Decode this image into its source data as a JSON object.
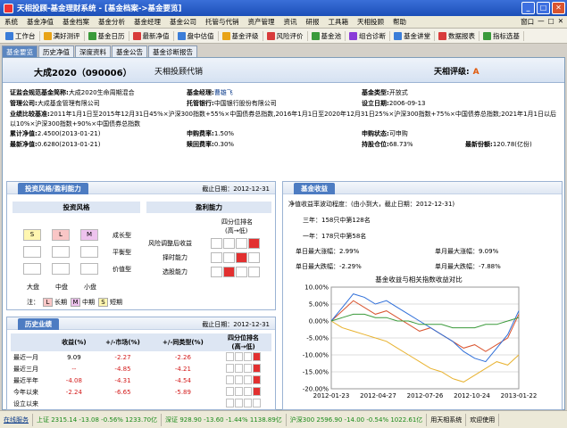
{
  "window": {
    "title": "天相投顾-基金理财系统 - [基金档案->基金要览]"
  },
  "menu": [
    "系统",
    "基金净值",
    "基金档案",
    "基金分析",
    "基金经理",
    "基金公司",
    "托管与代销",
    "资产管理",
    "资讯",
    "研报",
    "工具箱",
    "天相投顾",
    "帮助"
  ],
  "menu_right": [
    "窗口",
    "—",
    "□",
    "✕"
  ],
  "toolbar": [
    {
      "label": "工作台",
      "icon": "home-icon",
      "color": "#3b7dd8"
    },
    {
      "label": "满好测评",
      "icon": "star-icon",
      "color": "#e8a317"
    },
    {
      "label": "基金日历",
      "icon": "calendar-icon",
      "color": "#3a9a3a"
    },
    {
      "label": "最新净值",
      "icon": "chart-icon",
      "color": "#d83b3b"
    },
    {
      "label": "盘中估值",
      "icon": "monitor-icon",
      "color": "#3b7dd8"
    },
    {
      "label": "基金评级",
      "icon": "rating-icon",
      "color": "#e8a317"
    },
    {
      "label": "风险评价",
      "icon": "risk-icon",
      "color": "#d83b3b"
    },
    {
      "label": "基金池",
      "icon": "pool-icon",
      "color": "#3a9a3a"
    },
    {
      "label": "组合诊断",
      "icon": "diagnose-icon",
      "color": "#8a3bd8"
    },
    {
      "label": "基金讲堂",
      "icon": "lecture-icon",
      "color": "#3b7dd8"
    },
    {
      "label": "数据报表",
      "icon": "report-icon",
      "color": "#d83b3b"
    },
    {
      "label": "指标选基",
      "icon": "filter-icon",
      "color": "#3a9a3a"
    }
  ],
  "tabs": [
    "基金要览",
    "历史净值",
    "深度资料",
    "基金公告",
    "基金诊断报告"
  ],
  "fund": {
    "name": "大成2020（090006）",
    "adviser": "天相投顾代销",
    "rating_label": "天相评级:",
    "rating": "A"
  },
  "info": {
    "abbr_label": "证监会规范基金简称:",
    "abbr": "大成2020生命周期混合",
    "manager_label": "基金经理:",
    "manager": "曹雄飞",
    "type_label": "基金类型:",
    "type": "开放式",
    "company_label": "管理公司:",
    "company": "大成基金管理有限公司",
    "custodian_label": "托管银行:",
    "custodian": "中国银行股份有限公司",
    "setup_label": "设立日期:",
    "setup": "2006-09-13",
    "bench_label": "业绩比较基准:",
    "bench": "2011年1月1日至2015年12月31日45%×沪深300指数+55%×中国债券总指数,2016年1月1日至2020年12月31日25%×沪深300指数+75%×中国债券总指数;2021年1月1日以后以10%×沪深300指数+90%×中国债券总指数",
    "acc_nav_label": "累计净值:",
    "acc_nav": "2.4500(2013-01-21)",
    "sub_fee_label": "申购费率:",
    "sub_fee": "1.50%",
    "sub_status_label": "申购状态:",
    "sub_status": "可申购",
    "nav_label": "最新净值:",
    "nav": "0.6280(2013-01-21)",
    "red_fee_label": "赎回费率:",
    "red_fee": "0.30%",
    "stock_label": "持股仓位:",
    "stock": "68.73%",
    "share_label": "最新份额:",
    "share": "120.78(亿份)"
  },
  "style": {
    "title": "投资风格/盈利能力",
    "date": "截止日期：2012-12-31",
    "style_head": "投资风格",
    "profit_head": "盈利能力",
    "boxes": [
      {
        "t": "S",
        "c": "#fff6b0"
      },
      {
        "t": "L",
        "c": "#f9c6c6"
      },
      {
        "t": "M",
        "c": "#eec3ee"
      }
    ],
    "types": [
      "成长型",
      "平衡型",
      "价值型"
    ],
    "sizes": [
      "大盘",
      "中盘",
      "小盘"
    ],
    "legend_prefix": "注：",
    "legend": [
      {
        "t": "L",
        "c": "#f9c6c6",
        "l": "长期"
      },
      {
        "t": "M",
        "c": "#eec3ee",
        "l": "中期"
      },
      {
        "t": "S",
        "c": "#fff6b0",
        "l": "短期"
      }
    ],
    "rank_head": "四分位排名",
    "rank_sub": "(高→低)",
    "profit_rows": [
      {
        "label": "风险调整后收益",
        "rank": 4
      },
      {
        "label": "择时能力",
        "rank": 3
      },
      {
        "label": "选股能力",
        "rank": 2
      }
    ]
  },
  "history": {
    "title": "历史业绩",
    "date": "截止日期：2012-12-31",
    "headers": [
      "",
      "收益(%)",
      "+/-市场(%)",
      "+/-同类型(%)",
      "四分位排名\n(高→低)"
    ],
    "rows": [
      {
        "period": "最近一月",
        "ret": "9.09",
        "mkt": "-2.27",
        "peer": "-2.26",
        "rank": 4
      },
      {
        "period": "最近三月",
        "ret": "--",
        "mkt": "-4.85",
        "peer": "-4.21",
        "rank": 4
      },
      {
        "period": "最近半年",
        "ret": "-4.08",
        "mkt": "-4.31",
        "peer": "-4.54",
        "rank": 4
      },
      {
        "period": "今年以来",
        "ret": "-2.24",
        "peer": "-5.89",
        "mkt": "-6.65",
        "rank": 4
      },
      {
        "period": "设立以来",
        "ret": "",
        "mkt": "",
        "peer": "",
        "rank": 0
      }
    ]
  },
  "returns": {
    "title": "基金收益",
    "vol_label": "净值收益率波动程度：(由小到大，截止日期：2012-12-31)",
    "three_year": "三年：158只中第128名",
    "one_year": "一年：178只中第58名",
    "max_up_day_label": "单日最大涨幅：",
    "max_up_day": "2.99%",
    "max_down_day_label": "单日最大跌幅：",
    "max_down_day": "-2.29%",
    "max_up_month_label": "单月最大涨幅：",
    "max_up_month": "9.09%",
    "max_down_month_label": "单月最大跌幅：",
    "max_down_month": "-7.88%",
    "chart_title": "基金收益与相关指数收益对比"
  },
  "chart_data": {
    "type": "line",
    "title": "基金收益与相关指数收益对比",
    "x": [
      "2012-01-23",
      "2012-04-27",
      "2012-07-26",
      "2012-10-24",
      "2013-01-22"
    ],
    "ylim": [
      -20,
      10
    ],
    "yticks": [
      "10.00%",
      "5.00%",
      "0.00%",
      "-5.00%",
      "-10.00%",
      "-15.00%",
      "-20.00%"
    ],
    "series": [
      {
        "color": "#d9542f",
        "values": [
          0,
          3,
          6,
          4,
          2,
          3,
          1,
          -1,
          -3,
          -2,
          -4,
          -6,
          -8,
          -7,
          -9,
          -7,
          -5,
          2
        ]
      },
      {
        "color": "#2f6fd9",
        "values": [
          0,
          4,
          8,
          7,
          5,
          6,
          4,
          2,
          0,
          -2,
          -4,
          -6,
          -9,
          -11,
          -12,
          -8,
          -4,
          3
        ]
      },
      {
        "color": "#e8b22f",
        "values": [
          0,
          -2,
          -3,
          -4,
          -5,
          -6,
          -8,
          -10,
          -12,
          -14,
          -15,
          -17,
          -18,
          -16,
          -14,
          -12,
          -13,
          -10
        ]
      },
      {
        "color": "#3a9a3a",
        "values": [
          0,
          1,
          2,
          2,
          1,
          1,
          0,
          0,
          -1,
          -1,
          -1,
          -2,
          -2,
          -2,
          -1,
          -1,
          0,
          1
        ]
      }
    ]
  },
  "status": {
    "service": "在线服务",
    "sh": "上证 2315.14 -13.08 -0.56% 1233.70亿",
    "sz": "深证 928.90 -13.60 -1.44% 1138.89亿",
    "hs300": "沪深300 2596.90 -14.00 -0.54% 1022.61亿",
    "brand": "用天相系统",
    "welcome": "欢迎使用"
  }
}
